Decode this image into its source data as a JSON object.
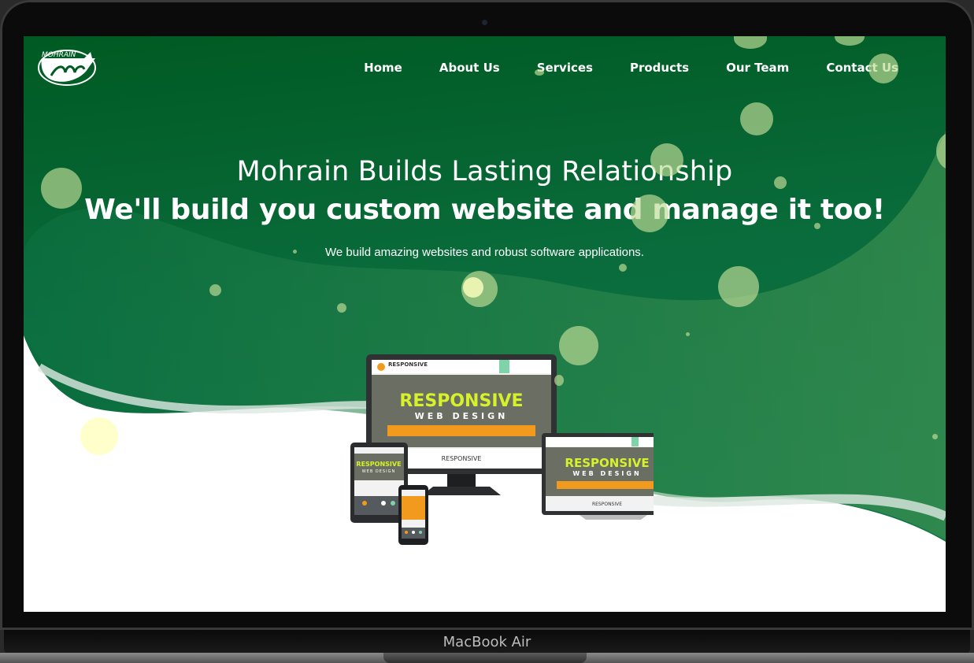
{
  "brand": {
    "logo_text": "MOHRAIN"
  },
  "nav": {
    "items": [
      {
        "label": "Home"
      },
      {
        "label": "About Us"
      },
      {
        "label": "Services"
      },
      {
        "label": "Products"
      },
      {
        "label": "Our Team"
      },
      {
        "label": "Contact Us"
      }
    ]
  },
  "hero": {
    "tagline": "Mohrain Builds Lasting Relationship",
    "headline": "We'll build you custom website and manage it too!",
    "subtext": "We build amazing websites and robust software applications."
  },
  "illustration": {
    "title_main": "RESPONSIVE",
    "title_sub": "WEB DESIGN",
    "footer_label": "RESPONSIVE"
  },
  "device": {
    "label": "MacBook Air"
  },
  "colors": {
    "green_dark": "#005a22",
    "green_mid": "#0b6e3a",
    "accent_yellow": "#d6f22a",
    "accent_orange": "#f29a1d"
  }
}
